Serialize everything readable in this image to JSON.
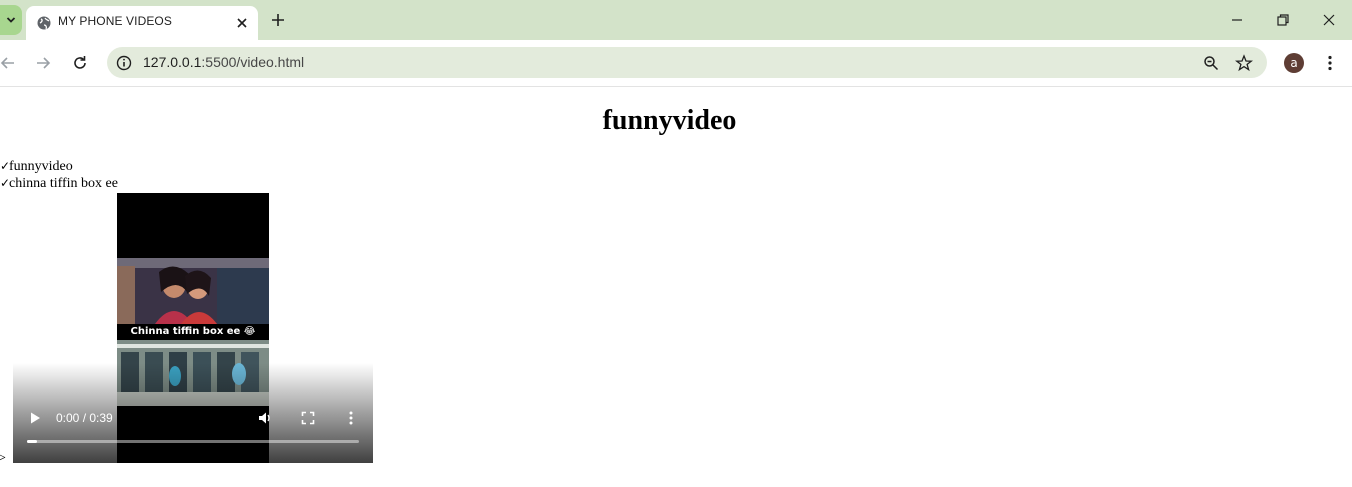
{
  "browser": {
    "tab_title": "MY PHONE VIDEOS",
    "url_host": "127.0.0.1",
    "url_path": ":5500/video.html",
    "profile_initial": "a",
    "accent": "#d3e3c9",
    "omnibox_color": "#e3ebdc"
  },
  "page": {
    "heading": "funnyvideo",
    "list_items": [
      {
        "marker": "✓",
        "label": "funnyvideo"
      },
      {
        "marker": "✓",
        "label": "chinna tiffin box ee"
      }
    ],
    "stray_text": ">"
  },
  "video": {
    "caption_in_frame": "Chinna tiffin box ee 😂",
    "time_display": "0:00 / 0:39",
    "progress_fraction": 0.03
  }
}
